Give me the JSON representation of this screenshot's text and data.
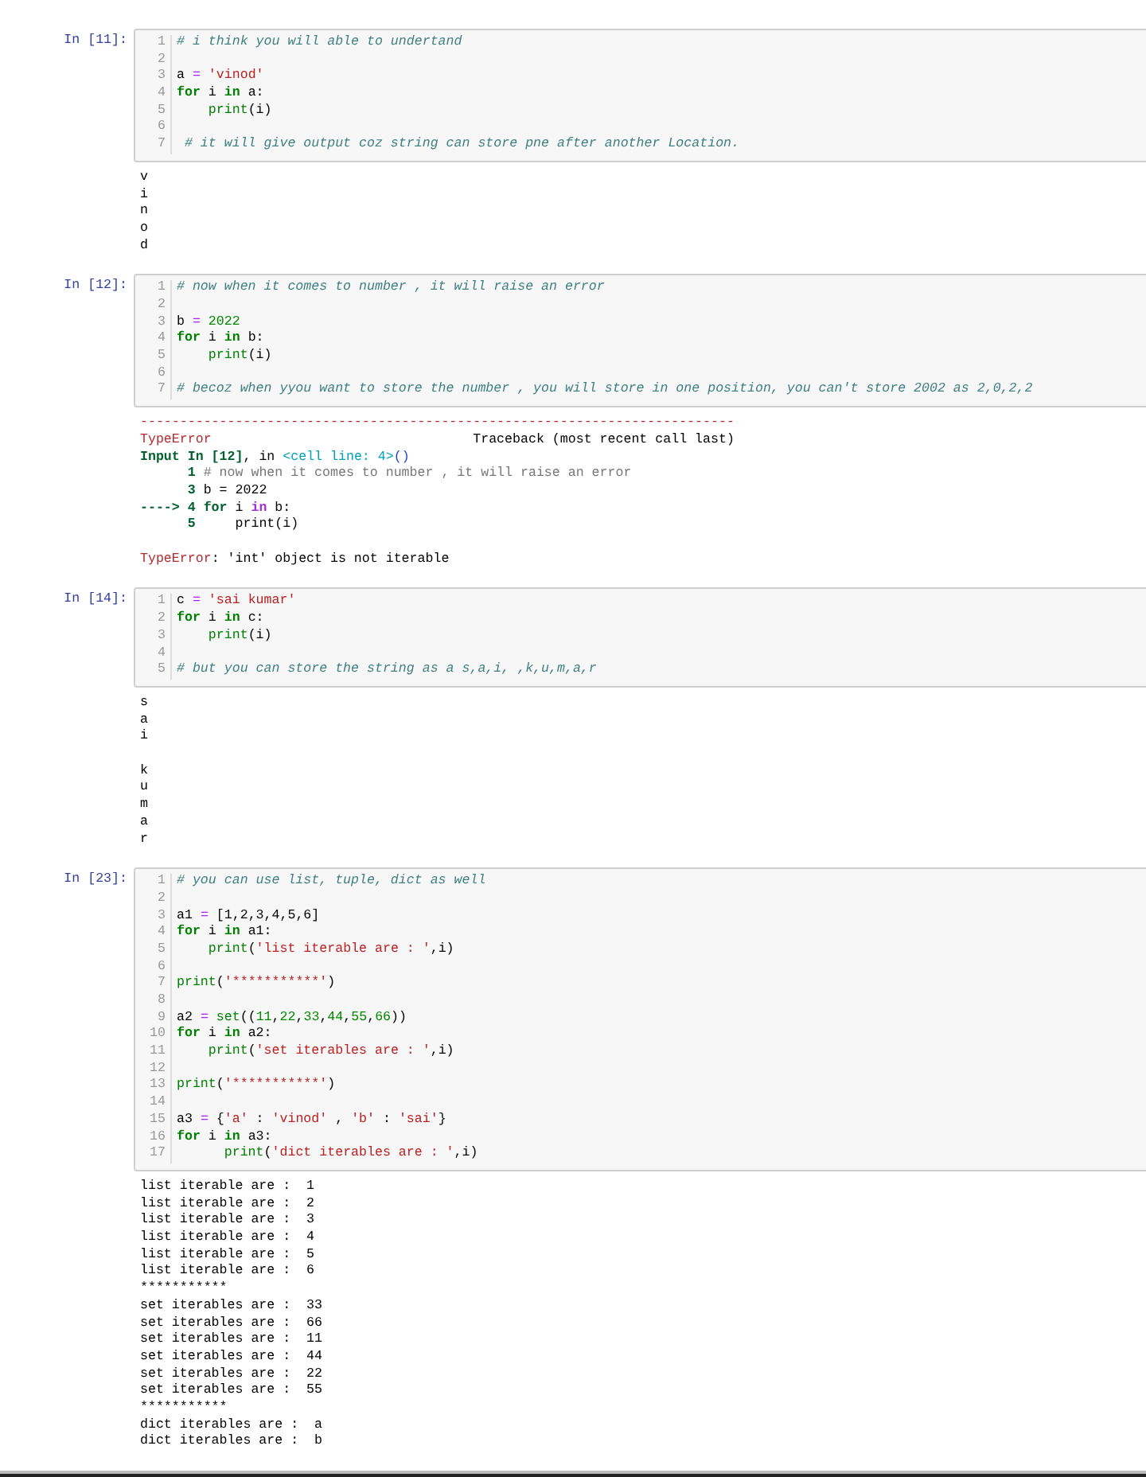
{
  "cells": [
    {
      "prompt": "In [11]:",
      "lines": [
        {
          "no": "1",
          "code": [
            {
              "kind": "comment",
              "text": "# i think you will able to undertand"
            }
          ]
        },
        {
          "no": "2"
        },
        {
          "no": "3",
          "code": [
            {
              "kind": "name",
              "text": "a "
            },
            {
              "kind": "op",
              "text": "="
            },
            {
              "kind": "string",
              "text": " 'vinod'"
            }
          ]
        },
        {
          "no": "4",
          "code": [
            {
              "kind": "keyword",
              "text": "for"
            },
            {
              "kind": "name",
              "text": " i "
            },
            {
              "kind": "keyword",
              "text": "in"
            },
            {
              "kind": "name",
              "text": " a:"
            }
          ]
        },
        {
          "no": "5",
          "code": [
            {
              "kind": "builtin",
              "text": "    print"
            },
            {
              "kind": "name",
              "text": "(i)"
            }
          ]
        },
        {
          "no": "6"
        },
        {
          "no": "7",
          "code": [
            {
              "kind": "comment",
              "text": " # it will give output coz string can store pne after another Location."
            }
          ]
        }
      ],
      "output": {
        "kind": "stream",
        "lines": [
          "v",
          "i",
          "n",
          "o",
          "d"
        ]
      }
    },
    {
      "prompt": "In [12]:",
      "lines": [
        {
          "no": "1",
          "code": [
            {
              "kind": "comment",
              "text": "# now when it comes to number , it will raise an error"
            }
          ]
        },
        {
          "no": "2"
        },
        {
          "no": "3",
          "code": [
            {
              "kind": "name",
              "text": "b "
            },
            {
              "kind": "op",
              "text": "="
            },
            {
              "kind": "number",
              "text": " 2022"
            }
          ]
        },
        {
          "no": "4",
          "code": [
            {
              "kind": "keyword",
              "text": "for"
            },
            {
              "kind": "name",
              "text": " i "
            },
            {
              "kind": "keyword",
              "text": "in"
            },
            {
              "kind": "name",
              "text": " b:"
            }
          ]
        },
        {
          "no": "5",
          "code": [
            {
              "kind": "builtin",
              "text": "    print"
            },
            {
              "kind": "name",
              "text": "(i)"
            }
          ]
        },
        {
          "no": "6"
        },
        {
          "no": "7",
          "code": [
            {
              "kind": "comment",
              "text": "# becoz when yyou want to store the number , you will store in one position, you can't store 2002 as 2,0,2,2"
            }
          ]
        }
      ],
      "output": {
        "kind": "error",
        "lines": [
          [
            {
              "kind": "red",
              "text": "---------------------------------------------------------------------------"
            }
          ],
          [
            {
              "kind": "red",
              "text": "TypeError"
            },
            {
              "kind": "plain",
              "text": "                                 Traceback (most recent call last)"
            }
          ],
          [
            {
              "kind": "green",
              "text": "Input In [12]"
            },
            {
              "kind": "plain",
              "text": ", in "
            },
            {
              "kind": "cyan",
              "text": "<cell line: 4>"
            },
            {
              "kind": "blue",
              "text": "()"
            }
          ],
          [
            {
              "kind": "green",
              "text": "      1"
            },
            {
              "kind": "dim",
              "text": " # now when it comes to number , it will raise an error"
            }
          ],
          [
            {
              "kind": "green",
              "text": "      3"
            },
            {
              "kind": "plain",
              "text": " b = 2022"
            }
          ],
          [
            {
              "kind": "green",
              "text": "----> 4 for"
            },
            {
              "kind": "plain",
              "text": " i "
            },
            {
              "kind": "purple",
              "text": "in"
            },
            {
              "kind": "plain",
              "text": " b:"
            }
          ],
          [
            {
              "kind": "green",
              "text": "      5"
            },
            {
              "kind": "plain",
              "text": "     print(i)"
            }
          ],
          [
            {
              "kind": "blank_line"
            },
            {
              "kind": "red",
              "text": "TypeError"
            },
            {
              "kind": "plain",
              "text": ": 'int' object is not iterable"
            }
          ]
        ]
      }
    },
    {
      "prompt": "In [14]:",
      "lines": [
        {
          "no": "1",
          "code": [
            {
              "kind": "name",
              "text": "c "
            },
            {
              "kind": "op",
              "text": "="
            },
            {
              "kind": "string",
              "text": " 'sai kumar'"
            }
          ]
        },
        {
          "no": "2",
          "code": [
            {
              "kind": "keyword",
              "text": "for"
            },
            {
              "kind": "name",
              "text": " i "
            },
            {
              "kind": "keyword",
              "text": "in"
            },
            {
              "kind": "name",
              "text": " c:"
            }
          ]
        },
        {
          "no": "3",
          "code": [
            {
              "kind": "builtin",
              "text": "    print"
            },
            {
              "kind": "name",
              "text": "(i)"
            }
          ]
        },
        {
          "no": "4"
        },
        {
          "no": "5",
          "code": [
            {
              "kind": "comment",
              "text": "# but you can store the string as a s,a,i, ,k,u,m,a,r"
            }
          ]
        }
      ],
      "output": {
        "kind": "stream",
        "lines": [
          "s",
          "a",
          "i",
          {
            "kind": "blank_line"
          },
          "k",
          "u",
          "m",
          "a",
          "r"
        ]
      }
    },
    {
      "prompt": "In [23]:",
      "lines": [
        {
          "no": "1",
          "code": [
            {
              "kind": "comment",
              "text": "# you can use list, tuple, dict as well"
            }
          ]
        },
        {
          "no": "2"
        },
        {
          "no": "3",
          "code": [
            {
              "kind": "name",
              "text": "a1 "
            },
            {
              "kind": "op",
              "text": "="
            },
            {
              "kind": "name",
              "text": " [1,2,3,4,5,6]"
            }
          ]
        },
        {
          "no": "4",
          "code": [
            {
              "kind": "keyword",
              "text": "for"
            },
            {
              "kind": "name",
              "text": " i "
            },
            {
              "kind": "keyword",
              "text": "in"
            },
            {
              "kind": "name",
              "text": " a1:"
            }
          ]
        },
        {
          "no": "5",
          "code": [
            {
              "kind": "builtin",
              "text": "    print"
            },
            {
              "kind": "name",
              "text": "("
            },
            {
              "kind": "string",
              "text": "'list iterable are : '"
            },
            {
              "kind": "name",
              "text": ",i)"
            }
          ]
        },
        {
          "no": "6"
        },
        {
          "no": "7",
          "code": [
            {
              "kind": "builtin",
              "text": "print"
            },
            {
              "kind": "name",
              "text": "("
            },
            {
              "kind": "string",
              "text": "'***********'"
            },
            {
              "kind": "name",
              "text": ")"
            }
          ]
        },
        {
          "no": "8"
        },
        {
          "no": "9",
          "code": [
            {
              "kind": "name",
              "text": "a2 "
            },
            {
              "kind": "op",
              "text": "="
            },
            {
              "kind": "builtin",
              "text": " set"
            },
            {
              "kind": "name",
              "text": "(("
            },
            {
              "kind": "number",
              "text": "11"
            },
            {
              "kind": "name",
              "text": ","
            },
            {
              "kind": "number",
              "text": "22"
            },
            {
              "kind": "name",
              "text": ","
            },
            {
              "kind": "number",
              "text": "33"
            },
            {
              "kind": "name",
              "text": ","
            },
            {
              "kind": "number",
              "text": "44"
            },
            {
              "kind": "name",
              "text": ","
            },
            {
              "kind": "number",
              "text": "55"
            },
            {
              "kind": "name",
              "text": ","
            },
            {
              "kind": "number",
              "text": "66"
            },
            {
              "kind": "name",
              "text": "))"
            }
          ]
        },
        {
          "no": "10",
          "code": [
            {
              "kind": "keyword",
              "text": "for"
            },
            {
              "kind": "name",
              "text": " i "
            },
            {
              "kind": "keyword",
              "text": "in"
            },
            {
              "kind": "name",
              "text": " a2:"
            }
          ]
        },
        {
          "no": "11",
          "code": [
            {
              "kind": "builtin",
              "text": "    print"
            },
            {
              "kind": "name",
              "text": "("
            },
            {
              "kind": "string",
              "text": "'set iterables are : '"
            },
            {
              "kind": "name",
              "text": ",i)"
            }
          ]
        },
        {
          "no": "12"
        },
        {
          "no": "13",
          "code": [
            {
              "kind": "builtin",
              "text": "print"
            },
            {
              "kind": "name",
              "text": "("
            },
            {
              "kind": "string",
              "text": "'***********'"
            },
            {
              "kind": "name",
              "text": ")"
            }
          ]
        },
        {
          "no": "14"
        },
        {
          "no": "15",
          "code": [
            {
              "kind": "name",
              "text": "a3 "
            },
            {
              "kind": "op",
              "text": "="
            },
            {
              "kind": "name",
              "text": " {"
            },
            {
              "kind": "string",
              "text": "'a'"
            },
            {
              "kind": "name",
              "text": " : "
            },
            {
              "kind": "string",
              "text": "'vinod'"
            },
            {
              "kind": "name",
              "text": " , "
            },
            {
              "kind": "string",
              "text": "'b'"
            },
            {
              "kind": "name",
              "text": " : "
            },
            {
              "kind": "string",
              "text": "'sai'"
            },
            {
              "kind": "name",
              "text": "}"
            }
          ]
        },
        {
          "no": "16",
          "code": [
            {
              "kind": "keyword",
              "text": "for"
            },
            {
              "kind": "name",
              "text": " i "
            },
            {
              "kind": "keyword",
              "text": "in"
            },
            {
              "kind": "name",
              "text": " a3:"
            }
          ]
        },
        {
          "no": "17",
          "code": [
            {
              "kind": "builtin",
              "text": "      print"
            },
            {
              "kind": "name",
              "text": "("
            },
            {
              "kind": "string",
              "text": "'dict iterables are : '"
            },
            {
              "kind": "name",
              "text": ",i)"
            }
          ]
        }
      ],
      "output": {
        "kind": "stream",
        "lines": [
          "list iterable are :  1",
          "list iterable are :  2",
          "list iterable are :  3",
          "list iterable are :  4",
          "list iterable are :  5",
          "list iterable are :  6",
          "***********",
          "set iterables are :  33",
          "set iterables are :  66",
          "set iterables are :  11",
          "set iterables are :  44",
          "set iterables are :  22",
          "set iterables are :  55",
          "***********",
          "dict iterables are :  a",
          "dict iterables are :  b"
        ]
      }
    }
  ]
}
